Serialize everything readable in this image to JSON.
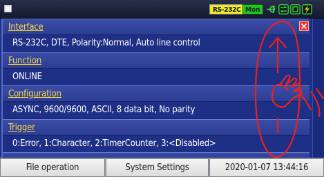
{
  "status_bar": {
    "port_badge": "RS-232C",
    "mode_badge": "Mon",
    "icons": [
      "window-icon",
      "usb-icon",
      "network-icon",
      "sd-card-icon",
      "power-icon"
    ]
  },
  "sections": [
    {
      "title": "Interface",
      "value": "RS-232C, DTE, Polarity:Normal, Auto line control"
    },
    {
      "title": "Function",
      "value": "ONLINE"
    },
    {
      "title": "Configuration",
      "value": "ASYNC, 9600/9600, ASCII, 8 data bit, No parity"
    },
    {
      "title": "Trigger",
      "value": "0:Error, 1:Character, 2:TimerCounter, 3:<Disabled>"
    }
  ],
  "bottom_bar": {
    "file_operation": "File operation",
    "system_settings": "System Settings",
    "datetime": "2020-01-07 13:44:16"
  },
  "colors": {
    "panel_bg": "#1e2f86",
    "section_title": "#ffd83a",
    "port_badge": "#f0ea2a",
    "mode_badge": "#22c32a",
    "close": "#e8342c",
    "gesture": "#e8231f"
  }
}
